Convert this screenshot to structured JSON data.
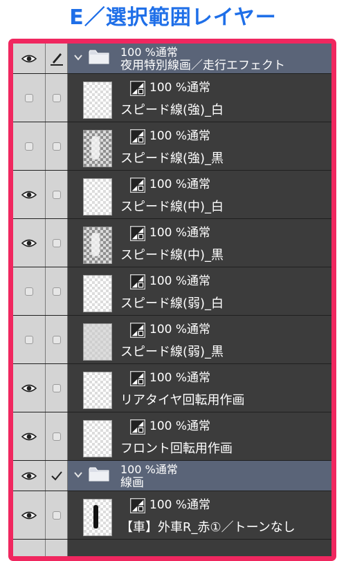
{
  "heading": "E／選択範囲レイヤー",
  "colors": {
    "accent": "#f0275f",
    "heading_text": "#1f6fe8",
    "folder_row": "#5a6478",
    "layer_row": "#3c3c3c"
  },
  "layers": [
    {
      "kind": "folder",
      "visible": true,
      "marker": "pen",
      "expanded": true,
      "mode": "100 %通常",
      "name": "夜用特別線画／走行エフェクト"
    },
    {
      "kind": "layer",
      "visible": false,
      "thumb": "light",
      "mode": "100 %通常",
      "name": "スピード線(強)_白"
    },
    {
      "kind": "layer",
      "visible": false,
      "thumb": "dark",
      "mode": "100 %通常",
      "name": "スピード線(強)_黒"
    },
    {
      "kind": "layer",
      "visible": true,
      "thumb": "light",
      "mode": "100 %通常",
      "name": "スピード線(中)_白"
    },
    {
      "kind": "layer",
      "visible": true,
      "thumb": "dark",
      "mode": "100 %通常",
      "name": "スピード線(中)_黒"
    },
    {
      "kind": "layer",
      "visible": false,
      "thumb": "light",
      "mode": "100 %通常",
      "name": "スピード線(弱)_白"
    },
    {
      "kind": "layer",
      "visible": false,
      "thumb": "grey",
      "mode": "100 %通常",
      "name": "スピード線(弱)_黒"
    },
    {
      "kind": "layer",
      "visible": true,
      "thumb": "light",
      "mode": "100 %通常",
      "name": "リアタイヤ回転用作画"
    },
    {
      "kind": "layer",
      "visible": true,
      "thumb": "light",
      "mode": "100 %通常",
      "name": "フロント回転用作画"
    },
    {
      "kind": "folder",
      "visible": true,
      "marker": "check",
      "expanded": true,
      "mode": "100 %通常",
      "name": "線画"
    },
    {
      "kind": "layer",
      "visible": true,
      "thumb": "black",
      "mode": "100 %通常",
      "name": "【車】外車R_赤①／トーンなし"
    }
  ]
}
